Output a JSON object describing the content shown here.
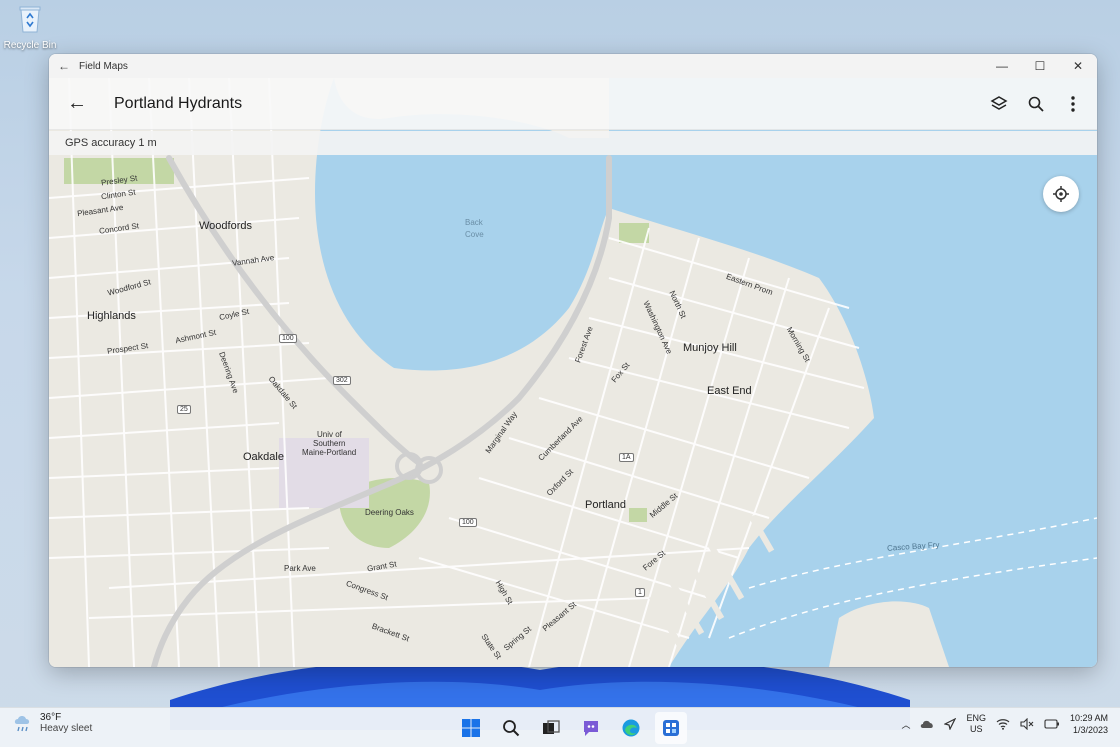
{
  "desktop": {
    "recycle_bin_label": "Recycle Bin"
  },
  "window": {
    "title": "Field Maps",
    "controls": {
      "minimize": "—",
      "maximize": "☐",
      "close": "✕"
    }
  },
  "appbar": {
    "title": "Portland Hydrants",
    "icons": [
      "layers-icon",
      "search-icon",
      "more-vertical-icon"
    ]
  },
  "gps": {
    "text": "GPS accuracy 1 m"
  },
  "map": {
    "places": {
      "woodfords": "Woodfords",
      "highlands": "Highlands",
      "oakdale": "Oakdale",
      "munjoy_hill": "Munjoy Hill",
      "east_end": "East End",
      "portland": "Portland",
      "back_cove_1": "Back",
      "back_cove_2": "Cove",
      "univ_1": "Univ of",
      "univ_2": "Southern",
      "univ_3": "Maine-Portland",
      "deering_oaks": "Deering Oaks"
    },
    "streets": {
      "presley": "Presley St",
      "clinton": "Clinton St",
      "pleasant": "Pleasant Ave",
      "concord": "Concord St",
      "vannah": "Vannah Ave",
      "woodford": "Woodford St",
      "coyle": "Coyle St",
      "ashmont": "Ashmont St",
      "prospect": "Prospect St",
      "deering": "Deering Ave",
      "oakdale_st": "Oakdale St",
      "park_ave": "Park Ave",
      "grant": "Grant St",
      "congress": "Congress St",
      "brackett": "Brackett St",
      "eastern_prom": "Eastern Prom",
      "north": "North St",
      "washington": "Washington Ave",
      "marginal": "Marginal Way",
      "forest": "Forest Ave",
      "fox": "Fox St",
      "cumberland": "Cumberland Ave",
      "oxford": "Oxford St",
      "middle": "Middle St",
      "fore": "Fore St",
      "high": "High St",
      "pleasant_st": "Pleasant St",
      "state": "State St",
      "spring": "Spring St",
      "casco_bay": "Casco Bay Fry",
      "morning": "Morning St"
    },
    "shields": {
      "r100a": "100",
      "r302": "302",
      "r25": "25",
      "r100b": "100",
      "r1a": "1A",
      "r1": "1"
    }
  },
  "taskbar": {
    "weather": {
      "temp": "36°F",
      "condition": "Heavy sleet"
    },
    "apps": [
      "windows-start-icon",
      "search-icon",
      "task-view-icon",
      "chat-icon",
      "edge-icon",
      "field-maps-icon"
    ],
    "tray": {
      "lang_1": "ENG",
      "lang_2": "US",
      "time": "10:29 AM",
      "date": "1/3/2023"
    }
  },
  "colors": {
    "water": "#a8d2ec",
    "land": "#ebe9e2",
    "park": "#c3d7a5",
    "road": "#ffffff",
    "highway": "#cfcfcf"
  }
}
